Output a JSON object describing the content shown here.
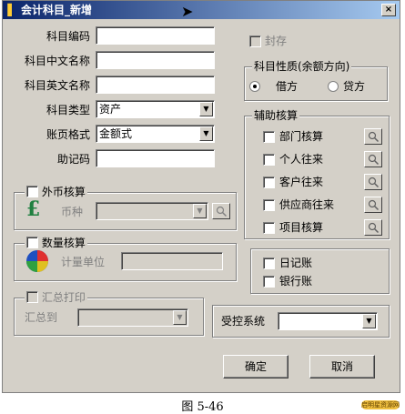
{
  "window": {
    "title": "会计科目_新增",
    "close_label": "×"
  },
  "form": {
    "code_label": "科目编码",
    "cn_name_label": "科目中文名称",
    "en_name_label": "科目英文名称",
    "type_label": "科目类型",
    "type_value": "资产",
    "format_label": "账页格式",
    "format_value": "金额式",
    "mnemonic_label": "助记码",
    "code_value": "",
    "cn_name_value": "",
    "en_name_value": "",
    "mnemonic_value": ""
  },
  "seal": {
    "label": "封存",
    "checked": false
  },
  "nature": {
    "title": "科目性质(余额方向)",
    "debit_label": "借方",
    "credit_label": "贷方",
    "selected": "借方"
  },
  "aux": {
    "title": "辅助核算",
    "items": [
      "部门核算",
      "个人往来",
      "客户往来",
      "供应商往来",
      "项目核算"
    ]
  },
  "foreign": {
    "title": "外币核算",
    "currency_label": "币种",
    "currency_value": ""
  },
  "quantity": {
    "title": "数量核算",
    "unit_label": "计量单位",
    "unit_value": ""
  },
  "summary": {
    "title": "汇总打印",
    "to_label": "汇总到",
    "to_value": ""
  },
  "journals": {
    "day_book": "日记账",
    "bank_book": "银行账"
  },
  "control": {
    "label": "受控系统",
    "value": ""
  },
  "buttons": {
    "ok": "确定",
    "cancel": "取消"
  },
  "caption": "图 5-46",
  "watermark": "启明星资源网"
}
